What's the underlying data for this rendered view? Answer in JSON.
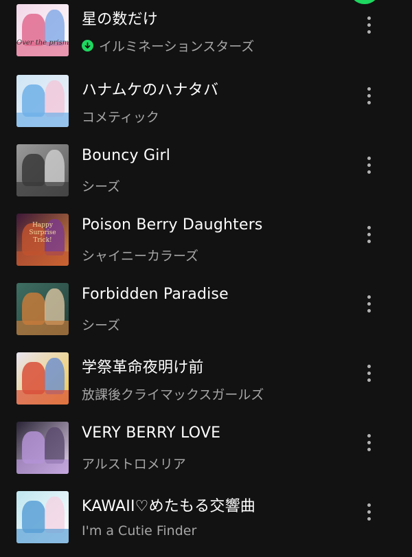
{
  "accent_color": "#1ed760",
  "tracks": [
    {
      "title": "星の数だけ",
      "artist": "イルミネーションスターズ",
      "downloaded": true,
      "art_text": "Over the prism",
      "colors": [
        "#f2d7e8",
        "#e06b8f",
        "#7fa8e6",
        "#ffffff"
      ]
    },
    {
      "title": "ハナムケのハナタバ",
      "artist": "コメティック",
      "downloaded": false,
      "colors": [
        "#cfe6f5",
        "#6fb0e8",
        "#f3c7d9",
        "#f0f0f8"
      ]
    },
    {
      "title": "Bouncy Girl",
      "artist": "シーズ",
      "downloaded": false,
      "colors": [
        "#9a9a9a",
        "#3a3a3a",
        "#d0d0d0",
        "#5c5c5c"
      ]
    },
    {
      "title": "Poison Berry Daughters",
      "artist": "シャイニーカラーズ",
      "downloaded": false,
      "art_text": "Happy Surprise Trick!",
      "colors": [
        "#3d1838",
        "#c0522f",
        "#7a3a8f",
        "#e08a3a"
      ]
    },
    {
      "title": "Forbidden Paradise",
      "artist": "シーズ",
      "downloaded": false,
      "colors": [
        "#3e6e62",
        "#c47a3a",
        "#d9c3a0",
        "#24403a"
      ]
    },
    {
      "title": "学祭革命夜明け前",
      "artist": "放課後クライマックスガールズ",
      "downloaded": false,
      "colors": [
        "#e8e4ef",
        "#d9503a",
        "#6a8fd0",
        "#f2c94c"
      ]
    },
    {
      "title": "VERY BERRY LOVE",
      "artist": "アルストロメリア",
      "downloaded": false,
      "colors": [
        "#2a2436",
        "#b493d6",
        "#5a4a6e",
        "#e9d8f2"
      ]
    },
    {
      "title": "KAWAII♡めたもる交響曲",
      "artist": "I'm a Cutie Finder",
      "downloaded": false,
      "colors": [
        "#bfe6ef",
        "#5aa0d6",
        "#f5d3e4",
        "#ffffff"
      ]
    }
  ]
}
